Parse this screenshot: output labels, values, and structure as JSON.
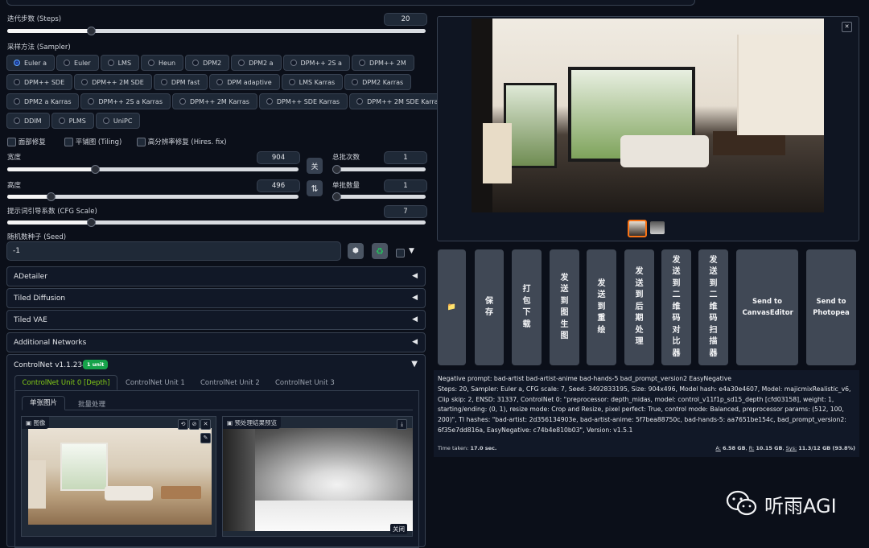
{
  "steps": {
    "label": "迭代步数 (Steps)",
    "value": "20",
    "fraction": 0.2
  },
  "sampler": {
    "label": "采样方法 (Sampler)",
    "rows": [
      [
        "Euler a",
        "Euler",
        "LMS",
        "Heun",
        "DPM2",
        "DPM2 a",
        "DPM++ 2S a",
        "DPM++ 2M"
      ],
      [
        "DPM++ SDE",
        "DPM++ 2M SDE",
        "DPM fast",
        "DPM adaptive",
        "LMS Karras",
        "DPM2 Karras"
      ],
      [
        "DPM2 a Karras",
        "DPM++ 2S a Karras",
        "DPM++ 2M Karras",
        "DPM++ SDE Karras",
        "DPM++ 2M SDE Karras"
      ],
      [
        "DDIM",
        "PLMS",
        "UniPC"
      ]
    ],
    "selected": "Euler a"
  },
  "options": {
    "restore_faces": "面部修复",
    "tiling": "平铺图 (Tiling)",
    "hires_fix": "高分辨率修复 (Hires. fix)"
  },
  "width": {
    "label": "宽度",
    "value": "904",
    "fraction": 0.3
  },
  "height": {
    "label": "高度",
    "value": "496",
    "fraction": 0.15
  },
  "swap_top_glyph": "关",
  "swap_icon_glyph": "⇅",
  "batch_count": {
    "label": "总批次数",
    "value": "1",
    "fraction": 0.0
  },
  "batch_size": {
    "label": "单批数量",
    "value": "1",
    "fraction": 0.0
  },
  "cfg": {
    "label": "提示词引导系数 (CFG Scale)",
    "value": "7",
    "fraction": 0.2
  },
  "seed": {
    "label": "随机数种子 (Seed)",
    "value": "-1",
    "dice_icon": "⬢",
    "recycle_icon": "♻",
    "extra_arrow": "▼"
  },
  "accordions": [
    "ADetailer",
    "Tiled Diffusion",
    "Tiled VAE",
    "Additional Networks"
  ],
  "acc_collapsed_arrow": "◀",
  "controlnet": {
    "title": "ControlNet v1.1.234",
    "badge": "1 unit",
    "arrow": "▼",
    "tabs": [
      "ControlNet Unit 0 [Depth]",
      "ControlNet Unit 1",
      "ControlNet Unit 2",
      "ControlNet Unit 3"
    ],
    "subtabs": [
      "单张图片",
      "批量处理"
    ],
    "image_label": "图像",
    "preview_label": "预处理结果预览",
    "close_label": "关闭",
    "image_tools": [
      "⟲",
      "⊘",
      "✕"
    ],
    "edit_icon": "✎",
    "download_icon": "⤓"
  },
  "output": {
    "close_icon": "✕",
    "folder_icon": "📁",
    "actions": [
      "保存",
      "打包下载",
      "发送到图生图",
      "发送到重绘",
      "发送到后期处理",
      "发送到二维码对比器",
      "发送到二维码扫描器",
      "Send to CanvasEditor",
      "Send to Photopea"
    ],
    "info": "Negative prompt: bad-artist bad-artist-anime bad-hands-5 bad_prompt_version2 EasyNegative\nSteps: 20, Sampler: Euler a, CFG scale: 7, Seed: 3492833195, Size: 904x496, Model hash: e4a30e4607, Model: majicmixRealistic_v6, Clip skip: 2, ENSD: 31337, ControlNet 0: \"preprocessor: depth_midas, model: control_v11f1p_sd15_depth [cfd03158], weight: 1, starting/ending: (0, 1), resize mode: Crop and Resize, pixel perfect: True, control mode: Balanced, preprocessor params: (512, 100, 200)\", TI hashes: \"bad-artist: 2d356134903e, bad-artist-anime: 5f7bea88750c, bad-hands-5: aa7651be154c, bad_prompt_version2: 6f35e7dd816a, EasyNegative: c74b4e810b03\", Version: v1.5.1",
    "time_taken_label": "Time taken:",
    "time_taken_value": "17.0 sec.",
    "mem_a_label": "A:",
    "mem_a": "6.58 GB",
    "mem_r_label": "R:",
    "mem_r": "10.15 GB",
    "mem_sys_label": "Sys:",
    "mem_sys": "11.3/12 GB (93.8%)"
  },
  "watermark": "听雨AGI"
}
